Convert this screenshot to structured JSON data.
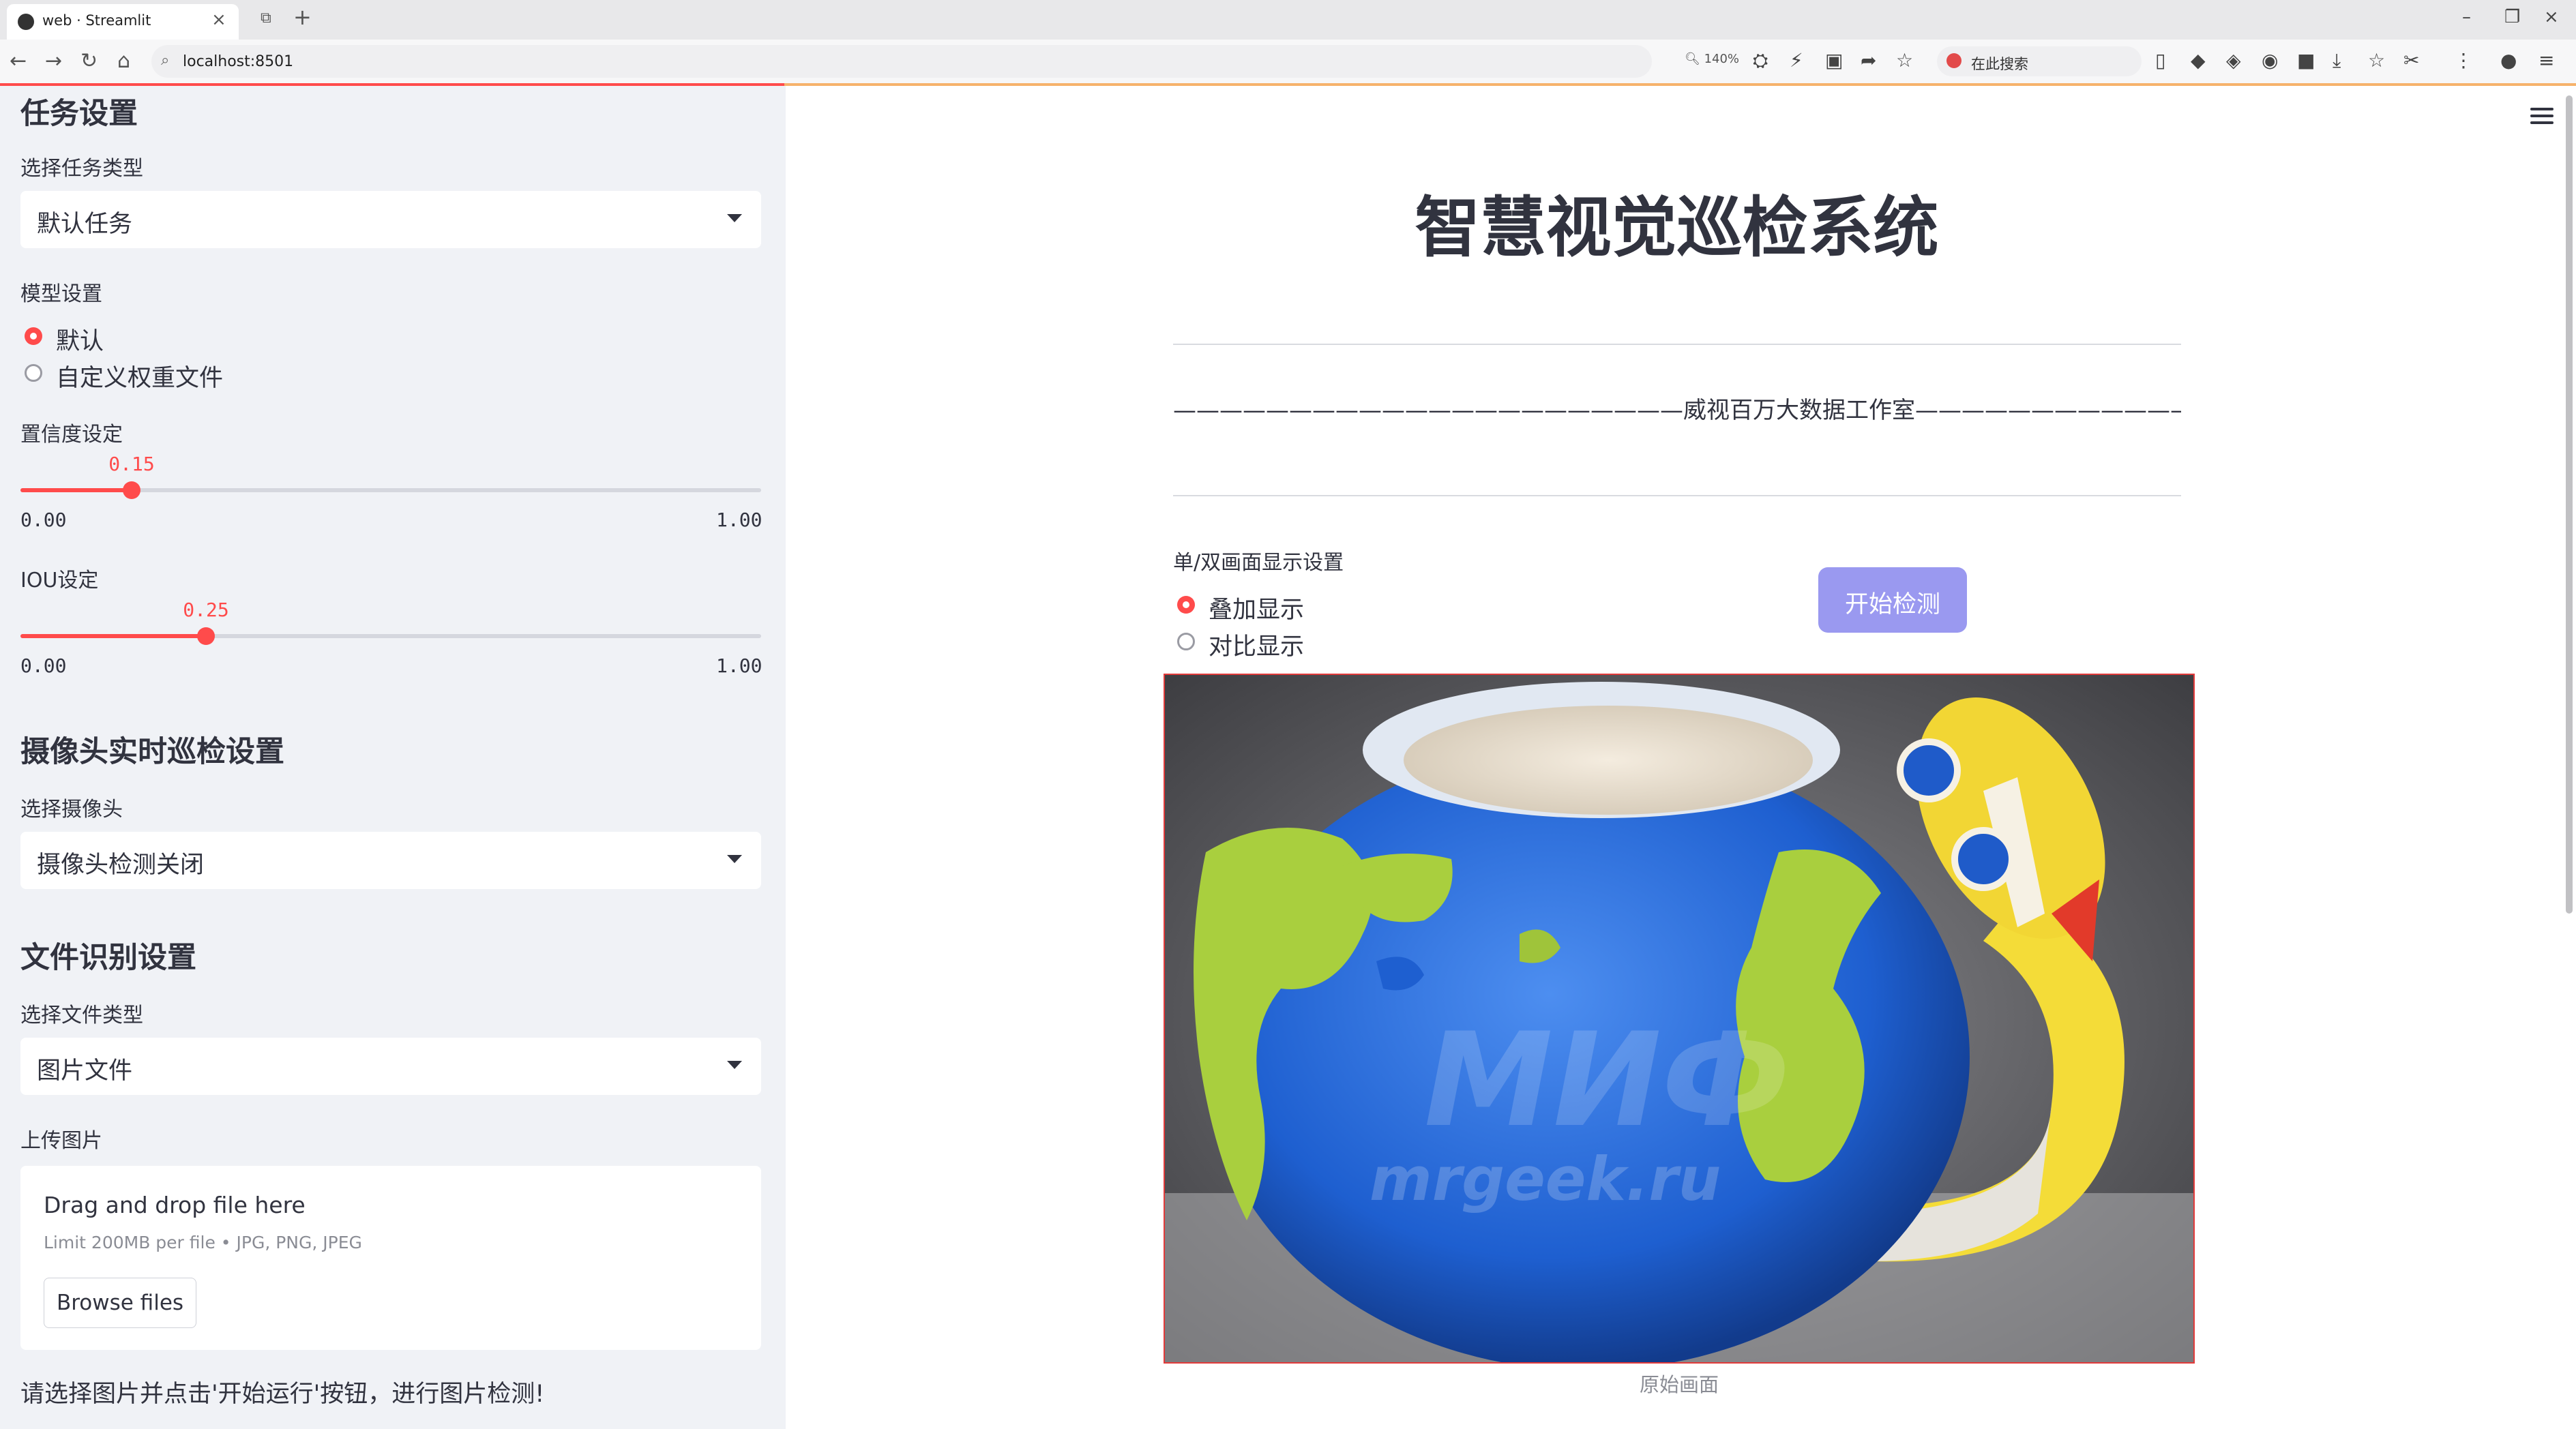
{
  "browser": {
    "tab_title": "web · Streamlit",
    "address": "localhost:8501",
    "zoom": "140%",
    "search_placeholder": "在此搜索"
  },
  "sidebar": {
    "task_section_title": "任务设置",
    "task_type_label": "选择任务类型",
    "task_type_value": "默认任务",
    "model_label": "模型设置",
    "model_options": [
      "默认",
      "自定义权重文件"
    ],
    "model_selected": 0,
    "confidence": {
      "label": "置信度设定",
      "value": "0.15",
      "value_num": 0.15,
      "min": "0.00",
      "max": "1.00"
    },
    "iou": {
      "label": "IOU设定",
      "value": "0.25",
      "value_num": 0.25,
      "min": "0.00",
      "max": "1.00"
    },
    "camera_section_title": "摄像头实时巡检设置",
    "camera_label": "选择摄像头",
    "camera_value": "摄像头检测关闭",
    "file_section_title": "文件识别设置",
    "file_type_label": "选择文件类型",
    "file_type_value": "图片文件",
    "upload_label": "上传图片",
    "uploader": {
      "drop_title": "Drag and drop file here",
      "limit": "Limit 200MB per file • JPG, PNG, JPEG",
      "browse": "Browse files"
    },
    "note": "请选择图片并点击'开始运行'按钮，进行图片检测!"
  },
  "main": {
    "title": "智慧视觉巡检系统",
    "studio_line": "——————————————————————威视百万大数据工作室———————————————————————",
    "display_label": "单/双画面显示设置",
    "display_options": [
      "叠加显示",
      "对比显示"
    ],
    "display_selected": 0,
    "start_button": "开始检测",
    "image_caption": "原始画面",
    "image_watermark": "mrgeek.ru"
  },
  "colors": {
    "accent": "#ff4b4b",
    "button": "#9a99f0",
    "sidebar_bg": "#f0f2f6",
    "text": "#31333F"
  }
}
